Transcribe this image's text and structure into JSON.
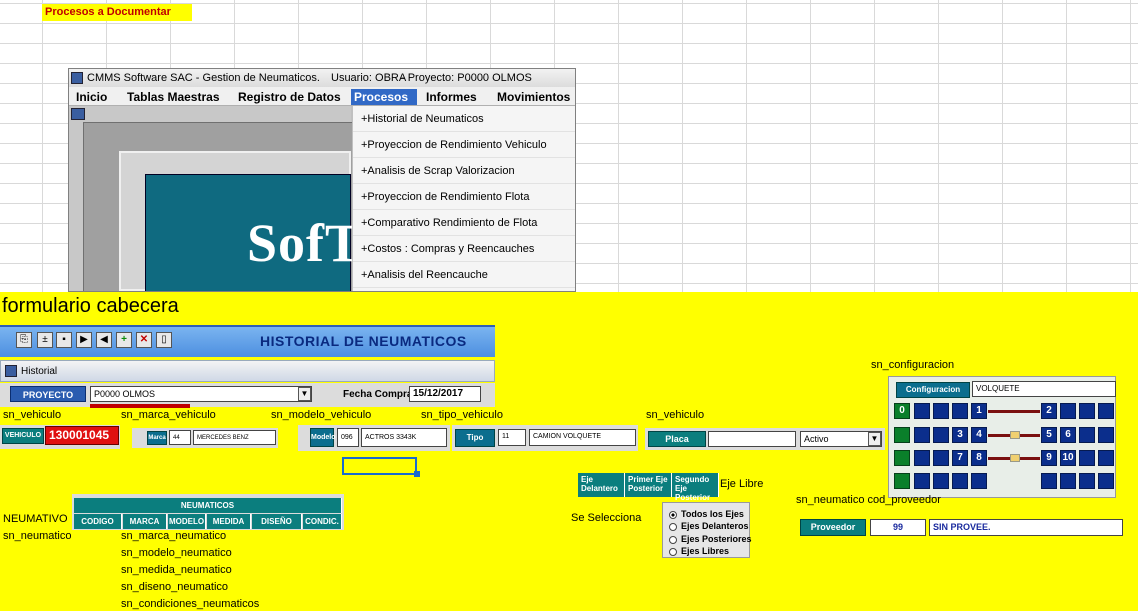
{
  "sheet": {
    "title": "Procesos a Documentar"
  },
  "app": {
    "title": "CMMS Software SAC - Gestion de Neumaticos.",
    "user": "Usuario: OBRA",
    "project": "- Proyecto: P0000 OLMOS",
    "menu": [
      "Inicio",
      "Tablas Maestras",
      "Registro de Datos",
      "Procesos",
      "Informes",
      "Movimientos"
    ],
    "active_menu": "Procesos",
    "dropdown": [
      "+Historial  de Neumaticos",
      "+Proyeccion de  Rendimiento Vehiculo",
      "+Analisis de Scrap  Valorizacion",
      "+Proyeccion de  Rendimiento Flota",
      "+Comparativo Rendimiento de Flota",
      "+Costos : Compras y Reencauches",
      "+Analisis del Reencauche"
    ],
    "splash_text": "SofT"
  },
  "section_title": "formulario cabecera",
  "form": {
    "header_title": "HISTORIAL  DE  NEUMATICOS",
    "window_label": "Historial",
    "proyecto_label": "PROYECTO",
    "proyecto_value": "P0000 OLMOS",
    "fecha_label": "Fecha Compra",
    "fecha_value": "15/12/2017",
    "vehiculo_label": "VEHICULO",
    "vehiculo_value": "130001045",
    "marca_label": "Marca",
    "marca_code": "44",
    "marca_value": "MERCEDES BENZ",
    "modelo_label": "Modelo",
    "modelo_code": "096",
    "modelo_value": "ACTROS 3343K",
    "tipo_label": "Tipo",
    "tipo_code": "11",
    "tipo_value": "CAMION VOLQUETE",
    "placa_label": "Placa",
    "placa_value": "",
    "estado_value": "Activo",
    "configuracion_label": "Configuracion",
    "configuracion_value": "VOLQUETE",
    "config_numbers": [
      "0",
      "1",
      "2",
      "3",
      "4",
      "5",
      "6",
      "7",
      "8",
      "9",
      "10"
    ],
    "proveedor_label": "Proveedor",
    "proveedor_code": "99",
    "proveedor_value": "SIN PROVEE.",
    "ejes_headers": [
      "Eje Delantero",
      "Primer Eje Posterior",
      "Segundo Eje Posterior"
    ],
    "radio_options": [
      "Todos los Ejes",
      "Ejes Delanteros",
      "Ejes Posteriores",
      "Ejes Libres"
    ],
    "radio_selected": "Todos los Ejes",
    "neumaticos_title": "NEUMATICOS",
    "neumaticos_columns": [
      "CODIGO",
      "MARCA",
      "MODELO",
      "MEDIDA",
      "DISEÑO",
      "CONDIC."
    ]
  },
  "annotations": {
    "sn_vehiculo_1": "sn_vehiculo",
    "sn_marca_vehiculo": "sn_marca_vehiculo",
    "sn_modelo_vehiculo": "sn_modelo_vehiculo",
    "sn_tipo_vehiculo": "sn_tipo_vehiculo",
    "sn_vehiculo_2": "sn_vehiculo",
    "sn_configuracion": "sn_configuracion",
    "eje_libre": "Eje Libre",
    "sn_neumatico_proveedor": "sn_neumatico cod_proveedor",
    "neumativo": "NEUMATIVO",
    "sn_neumatico": "sn_neumatico",
    "se_selecciona": "Se Selecciona",
    "sn_marca_neumatico": "sn_marca_neumatico",
    "sn_modelo_neumatico": "sn_modelo_neumatico",
    "sn_medida_neumatico": "sn_medida_neumatico",
    "sn_diseno_neumatico": "sn_diseno_neumatico",
    "sn_condiciones_neumaticos": "sn_condiciones_neumaticos"
  }
}
